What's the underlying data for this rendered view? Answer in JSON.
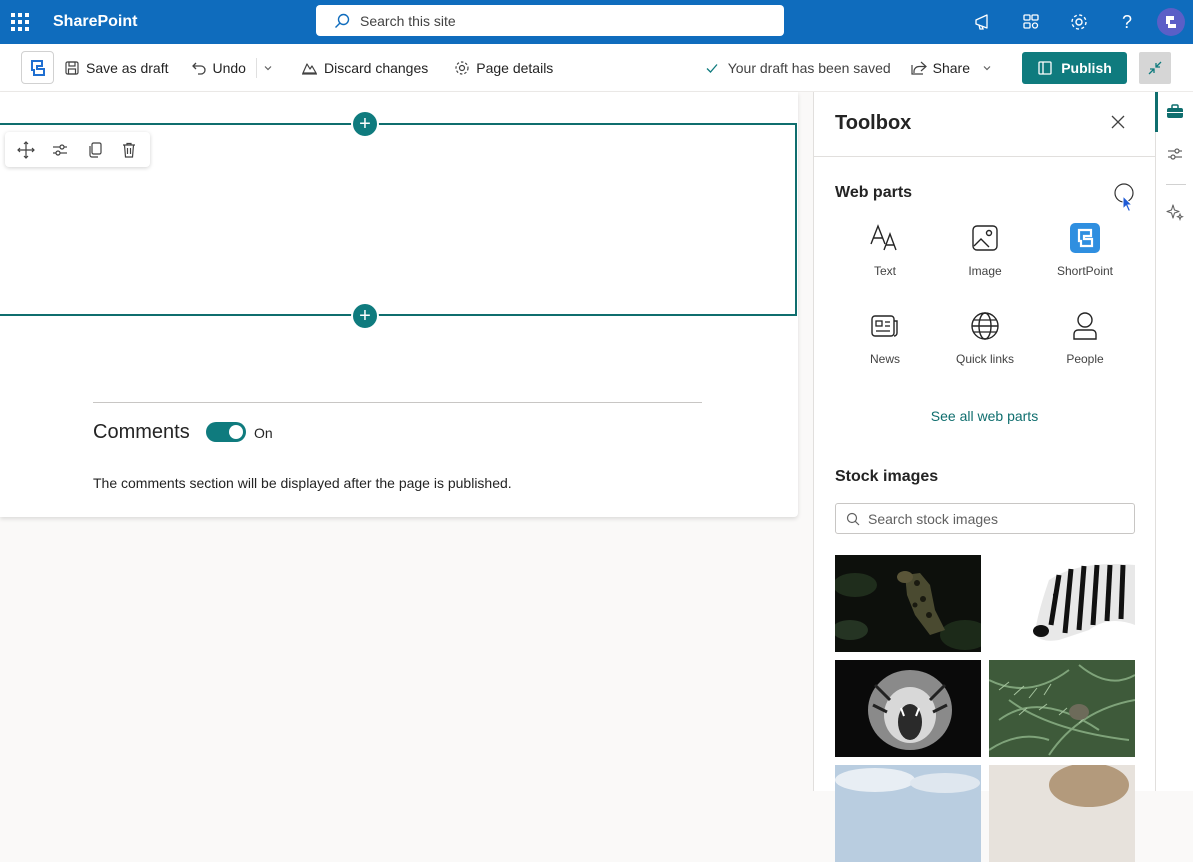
{
  "suitebar": {
    "app_name": "SharePoint",
    "search_placeholder": "Search this site",
    "icons": [
      "megaphone-icon",
      "apps-icon",
      "gear-icon",
      "help-icon",
      "avatar-icon"
    ],
    "help_glyph": "?"
  },
  "commandbar": {
    "save_draft": "Save as draft",
    "undo": "Undo",
    "discard": "Discard changes",
    "page_details": "Page details",
    "draft_status": "Your draft has been saved",
    "share": "Share",
    "publish": "Publish"
  },
  "canvas": {
    "add_glyph": "+",
    "comments_title": "Comments",
    "comments_toggle_label": "On",
    "comments_toggle_on": true,
    "comments_note": "The comments section will be displayed after the page is published."
  },
  "toolbox": {
    "title": "Toolbox",
    "web_parts_heading": "Web parts",
    "web_parts": [
      {
        "label": "Text",
        "icon": "text-icon"
      },
      {
        "label": "Image",
        "icon": "image-icon"
      },
      {
        "label": "ShortPoint",
        "icon": "shortpoint-icon"
      },
      {
        "label": "News",
        "icon": "news-icon"
      },
      {
        "label": "Quick links",
        "icon": "globe-icon"
      },
      {
        "label": "People",
        "icon": "person-icon"
      }
    ],
    "see_all": "See all web parts",
    "stock_heading": "Stock images",
    "stock_search_placeholder": "Search stock images",
    "stock_images": [
      "ocelot-image",
      "zebra-image",
      "tiger-image",
      "ferns-image",
      "sky-image",
      "animal-image"
    ]
  },
  "colors": {
    "suite_blue": "#0f6cbd",
    "teal": "#0f7b7e",
    "shortpoint_blue": "#2f8fe0"
  }
}
